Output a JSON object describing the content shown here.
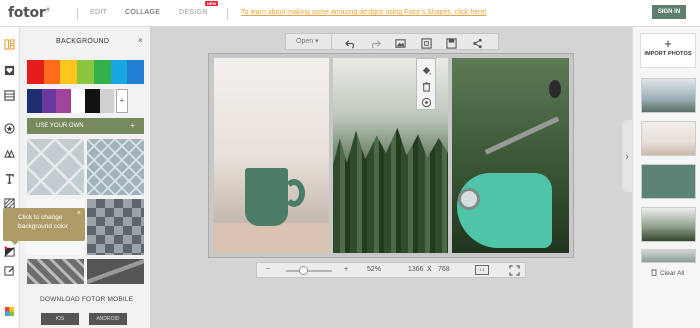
{
  "header": {
    "logo": "fotor",
    "logo_mark": "®",
    "nav": [
      "EDIT",
      "COLLAGE",
      "DESIGN"
    ],
    "new_badge": "NEW",
    "promo": "To learn about making some amazing designs using Fotor's Shapes, click here!",
    "signin": "SIGN IN"
  },
  "sidebar": {
    "icons": [
      "layout-icon",
      "heart-icon",
      "grid-icon",
      "star-icon",
      "shapes-icon",
      "text-icon",
      "pattern-icon",
      "background-icon",
      "edit-icon",
      "palette-icon"
    ]
  },
  "panel": {
    "title": "BACKGROUND",
    "close": "×",
    "colors_row1": [
      "#e31c1c",
      "#ff6a1a",
      "#ffc61a",
      "#8cc63f",
      "#33b049",
      "#1aa7e0",
      "#1f7fd1"
    ],
    "colors_row2": [
      "#1d2f6e",
      "#6a3aa0",
      "#a0449a",
      "#ffffff",
      "#111111",
      "#d0d0d0"
    ],
    "add_color": "+",
    "use_your_own": "USE YOUR OWN",
    "use_your_own_plus": "+",
    "download_title": "DOWNLOAD FOTOR MOBILE",
    "ios": "IOS",
    "android": "ANDROID"
  },
  "tooltip": {
    "line1": "Click to change",
    "line2": "background color",
    "close": "×"
  },
  "toolbar": {
    "open": "Open",
    "open_arrow": "▾"
  },
  "zoom": {
    "minus": "−",
    "plus": "+",
    "percent": "52%",
    "width": "1366",
    "x": "X",
    "height": "768",
    "ratio": "1:1"
  },
  "right": {
    "import_plus": "+",
    "import_label": "IMPORT PHOTOS",
    "collapse": "›",
    "clear_all": "Clear All"
  }
}
